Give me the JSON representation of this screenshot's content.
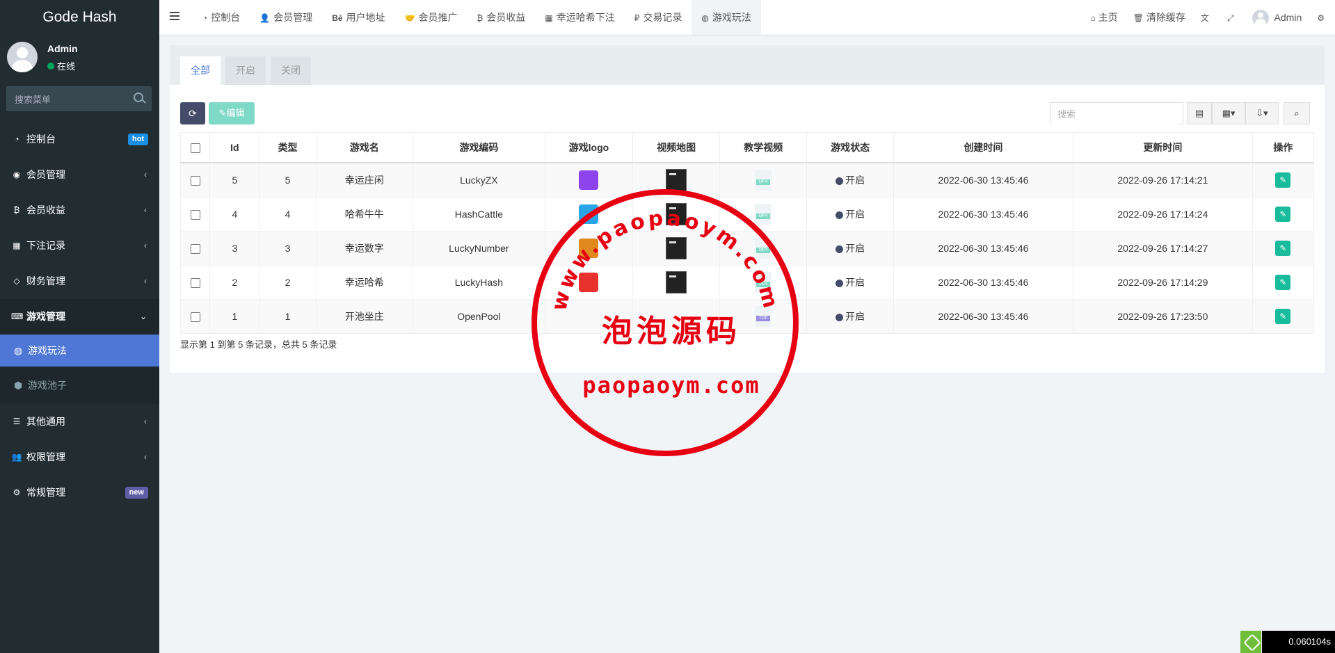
{
  "brand": "Gode Hash",
  "user": {
    "name": "Admin",
    "status": "在线"
  },
  "sidebar": {
    "search_placeholder": "搜索菜单",
    "items": [
      {
        "label": "控制台",
        "icon": "dashboard-icon",
        "badge": "hot"
      },
      {
        "label": "会员管理",
        "icon": "user-circle-icon"
      },
      {
        "label": "会员收益",
        "icon": "bitcoin-icon"
      },
      {
        "label": "下注记录",
        "icon": "calendar-icon"
      },
      {
        "label": "财务管理",
        "icon": "diamond-icon"
      },
      {
        "label": "游戏管理",
        "icon": "gamepad-icon"
      },
      {
        "label": "其他通用",
        "icon": "list-icon"
      },
      {
        "label": "权限管理",
        "icon": "users-icon"
      },
      {
        "label": "常规管理",
        "icon": "gears-icon",
        "badge": "new"
      }
    ],
    "sub_items": [
      {
        "label": "游戏玩法",
        "icon": "dribbble-icon",
        "active": true
      },
      {
        "label": "游戏池子",
        "icon": "cube-icon"
      }
    ]
  },
  "header": {
    "tabs": [
      {
        "label": "控制台",
        "icon": "dashboard-icon"
      },
      {
        "label": "会员管理",
        "icon": "user-icon"
      },
      {
        "label": "用户地址",
        "icon": "behance-icon"
      },
      {
        "label": "会员推广",
        "icon": "handshake-icon"
      },
      {
        "label": "会员收益",
        "icon": "bitcoin-icon"
      },
      {
        "label": "幸运哈希下注",
        "icon": "calendar-check-icon"
      },
      {
        "label": "交易记录",
        "icon": "ruble-icon"
      },
      {
        "label": "游戏玩法",
        "icon": "dribbble-icon",
        "active": true
      }
    ],
    "right": [
      {
        "label": "主页",
        "icon": "home-icon"
      },
      {
        "label": "清除缓存",
        "icon": "trash-icon"
      },
      {
        "label": "",
        "icon": "language-icon"
      },
      {
        "label": "",
        "icon": "fullscreen-icon"
      },
      {
        "label": "Admin",
        "icon": "avatar"
      },
      {
        "label": "",
        "icon": "gears-icon"
      }
    ]
  },
  "filter_tabs": [
    "全部",
    "开启",
    "关闭"
  ],
  "toolbar": {
    "edit_label": "编辑",
    "search_placeholder": "搜索"
  },
  "table": {
    "columns": [
      "Id",
      "类型",
      "游戏名",
      "游戏编码",
      "游戏logo",
      "视频地图",
      "教学视频",
      "游戏状态",
      "创建时间",
      "更新时间",
      "操作"
    ],
    "rows": [
      {
        "id": "5",
        "type": "5",
        "name": "幸运庄闲",
        "code": "LuckyZX",
        "status": "开启",
        "created": "2022-06-30 13:45:46",
        "updated": "2022-09-26 17:14:21",
        "logo_color": "#8e44ec",
        "video_file": "MP4"
      },
      {
        "id": "4",
        "type": "4",
        "name": "哈希牛牛",
        "code": "HashCattle",
        "status": "开启",
        "created": "2022-06-30 13:45:46",
        "updated": "2022-09-26 17:14:24",
        "logo_color": "#2aa6e8",
        "video_file": "MP4"
      },
      {
        "id": "3",
        "type": "3",
        "name": "幸运数字",
        "code": "LuckyNumber",
        "status": "开启",
        "created": "2022-06-30 13:45:46",
        "updated": "2022-09-26 17:14:27",
        "logo_color": "#e08a1e",
        "video_file": "MP4"
      },
      {
        "id": "2",
        "type": "2",
        "name": "幸运哈希",
        "code": "LuckyHash",
        "status": "开启",
        "created": "2022-06-30 13:45:46",
        "updated": "2022-09-26 17:14:29",
        "logo_color": "#e8322e",
        "video_file": "MP4"
      },
      {
        "id": "1",
        "type": "1",
        "name": "开池坐庄",
        "code": "OpenPool",
        "status": "开启",
        "created": "2022-06-30 13:45:46",
        "updated": "2022-09-26 17:23:50",
        "logo_color": "",
        "video_file": "TOP"
      }
    ]
  },
  "pager_info": "显示第 1 到第 5 条记录，总共 5 条记录",
  "watermark": {
    "arc_text": "www.paopaoym.com",
    "center_text": "泡泡源码",
    "bottom_text": "paopaoym.com"
  },
  "timer": "0.060104s",
  "colors": {
    "sidebar": "#222d32",
    "active": "#4e77d6",
    "edit": "#18bc9c",
    "stamp": "#e60012"
  }
}
